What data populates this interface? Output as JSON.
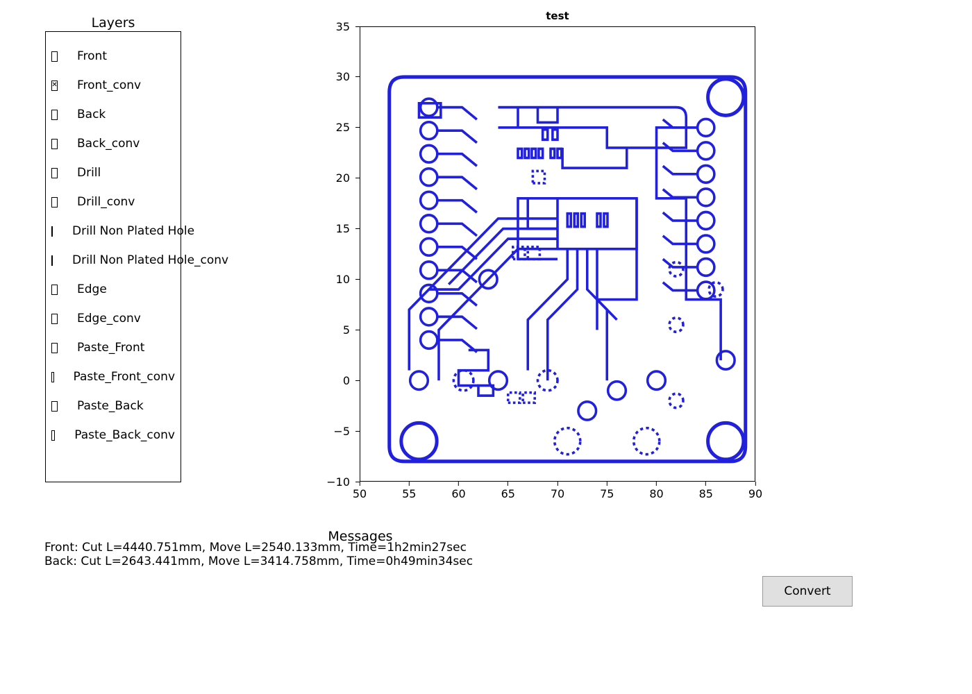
{
  "layers": {
    "title": "Layers",
    "items": [
      {
        "label": "Front",
        "checked": false
      },
      {
        "label": "Front_conv",
        "checked": true
      },
      {
        "label": "Back",
        "checked": false
      },
      {
        "label": "Back_conv",
        "checked": false
      },
      {
        "label": "Drill",
        "checked": false
      },
      {
        "label": "Drill_conv",
        "checked": false
      },
      {
        "label": "Drill Non Plated Hole",
        "checked": false
      },
      {
        "label": "Drill Non Plated Hole_conv",
        "checked": false
      },
      {
        "label": "Edge",
        "checked": false
      },
      {
        "label": "Edge_conv",
        "checked": false
      },
      {
        "label": "Paste_Front",
        "checked": false
      },
      {
        "label": "Paste_Front_conv",
        "checked": false
      },
      {
        "label": "Paste_Back",
        "checked": false
      },
      {
        "label": "Paste_Back_conv",
        "checked": false
      }
    ]
  },
  "chart": {
    "title": "test",
    "x_ticks": [
      50,
      55,
      60,
      65,
      70,
      75,
      80,
      85,
      90
    ],
    "y_ticks": [
      -10,
      -5,
      0,
      5,
      10,
      15,
      20,
      25,
      30,
      35
    ],
    "x_range": [
      50,
      90
    ],
    "y_range": [
      -10,
      35
    ],
    "stroke_color": "#2020dd"
  },
  "messages": {
    "title": "Messages",
    "lines": [
      "Front: Cut L=4440.751mm, Move L=2540.133mm, Time=1h2min27sec",
      "Back: Cut L=2643.441mm, Move L=3414.758mm, Time=0h49min34sec"
    ]
  },
  "buttons": {
    "convert": "Convert"
  },
  "chart_data": {
    "type": "pcb_layout",
    "title": "test",
    "xlabel": "",
    "ylabel": "",
    "xlim": [
      50,
      90
    ],
    "ylim": [
      -10,
      35
    ],
    "description": "PCB front copper layer outline (Front_conv) showing board outline, pads, traces, and mounting/drill holes",
    "board_outline": {
      "x": [
        53,
        89
      ],
      "y": [
        -8,
        30
      ]
    },
    "mounting_holes": [
      {
        "x": 56,
        "y": -6,
        "r": 1.8
      },
      {
        "x": 87,
        "y": -6,
        "r": 1.8
      },
      {
        "x": 87,
        "y": 28,
        "r": 1.8
      }
    ],
    "pad_rows_left": {
      "x_start": 57,
      "count": 11,
      "y_start": 27,
      "y_step": -2.3
    },
    "pad_rows_right": {
      "x_start": 85,
      "count": 8,
      "y_start": 25,
      "y_step": -2.3
    },
    "dashed_circles": [
      {
        "x": 60.5,
        "y": 0,
        "r": 1.0
      },
      {
        "x": 69,
        "y": 0,
        "r": 1.0
      },
      {
        "x": 82,
        "y": 11,
        "r": 0.7
      },
      {
        "x": 82,
        "y": 5.5,
        "r": 0.7
      },
      {
        "x": 86,
        "y": 9,
        "r": 0.7
      },
      {
        "x": 82,
        "y": -2,
        "r": 0.7
      },
      {
        "x": 71,
        "y": -6,
        "r": 1.3
      },
      {
        "x": 79,
        "y": -6,
        "r": 1.3
      }
    ],
    "small_solid_circles": [
      {
        "x": 56,
        "y": 0
      },
      {
        "x": 64,
        "y": 0
      },
      {
        "x": 80,
        "y": 0
      },
      {
        "x": 76,
        "y": -1
      },
      {
        "x": 73,
        "y": -3
      },
      {
        "x": 63,
        "y": 10
      },
      {
        "x": 87,
        "y": 2
      }
    ]
  }
}
